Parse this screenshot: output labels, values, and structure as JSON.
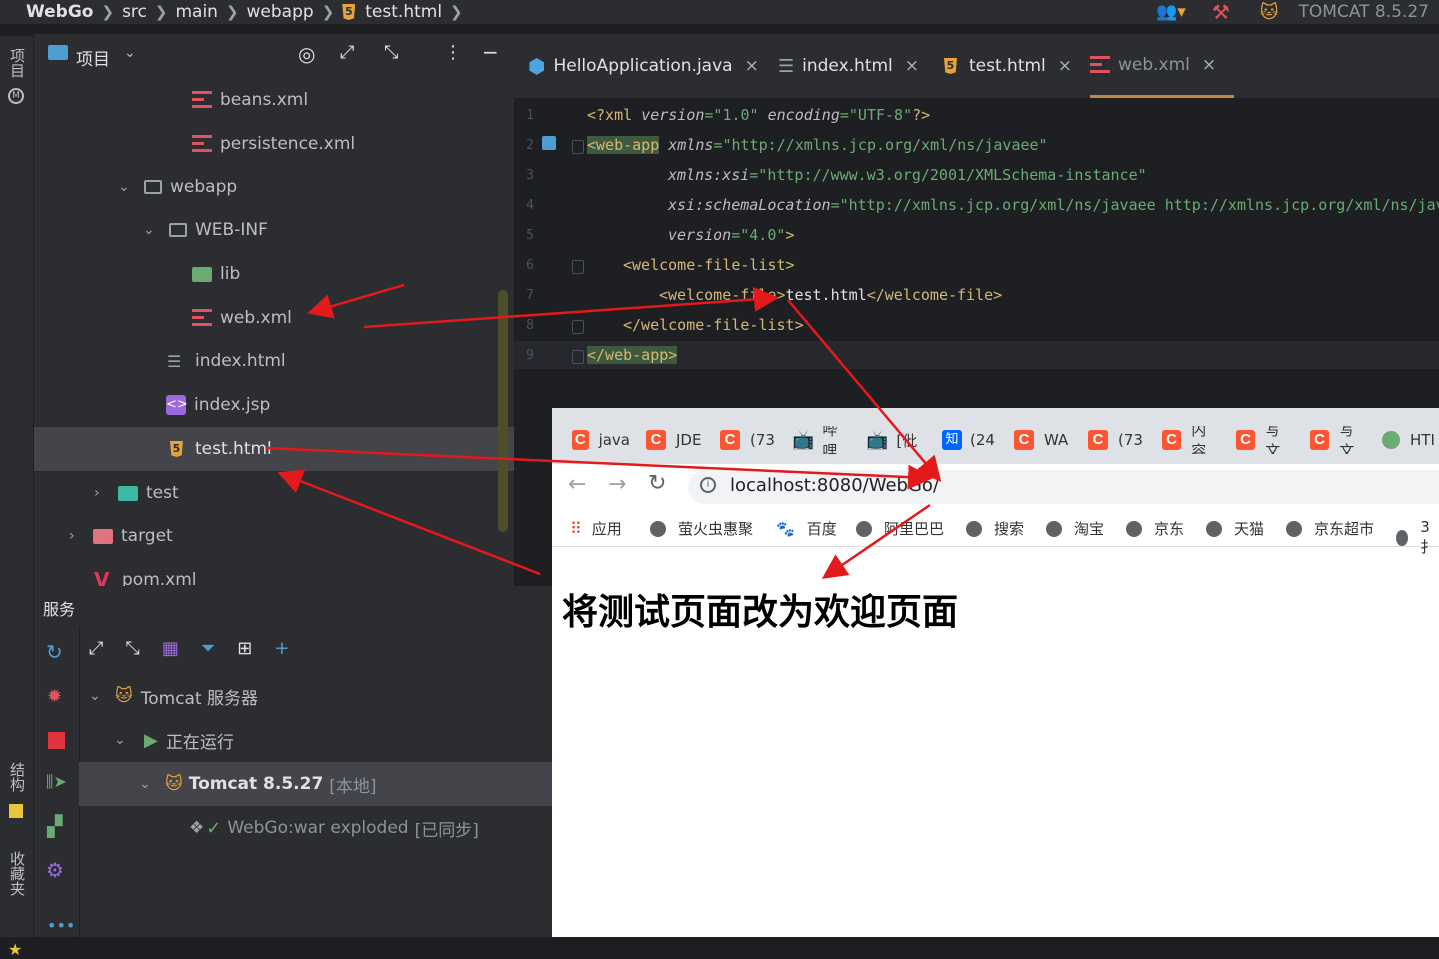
{
  "breadcrumb": {
    "items": [
      "WebGo",
      "src",
      "main",
      "webapp",
      "test.html"
    ]
  },
  "toolbar": {
    "run_config": "TOMCAT 8.5.27"
  },
  "left_strip": {
    "project_label": "项目",
    "structure_label": "结构",
    "favorites_label": "收藏夹"
  },
  "project_panel": {
    "title": "项目",
    "tree": [
      {
        "label": "beans.xml",
        "type": "xml"
      },
      {
        "label": "persistence.xml",
        "type": "xml"
      },
      {
        "label": "webapp",
        "type": "folder",
        "expanded": true
      },
      {
        "label": "WEB-INF",
        "type": "folder",
        "expanded": true
      },
      {
        "label": "lib",
        "type": "lib-folder"
      },
      {
        "label": "web.xml",
        "type": "xml"
      },
      {
        "label": "index.html",
        "type": "html"
      },
      {
        "label": "index.jsp",
        "type": "jsp"
      },
      {
        "label": "test.html",
        "type": "html5",
        "selected": true
      },
      {
        "label": "test",
        "type": "test-folder",
        "expanded": false
      },
      {
        "label": "target",
        "type": "target-folder",
        "expanded": false
      },
      {
        "label": "pom.xml",
        "type": "maven"
      }
    ]
  },
  "editor": {
    "tabs": [
      {
        "label": "HelloApplication.java"
      },
      {
        "label": "index.html"
      },
      {
        "label": "test.html"
      },
      {
        "label": "web.xml",
        "active": true
      }
    ],
    "line_numbers": [
      "1",
      "2",
      "3",
      "4",
      "5",
      "6",
      "7",
      "8",
      "9"
    ],
    "code": {
      "l1_prolog_open": "<?xml ",
      "l1_attr1": "version",
      "l1_val1": "=\"1.0\" ",
      "l1_attr2": "encoding",
      "l1_val2": "=\"UTF-8\"",
      "l1_close": "?>",
      "l2_tag": "<web-app",
      "l2_attr": " xmlns",
      "l2_val": "=\"http://xmlns.jcp.org/xml/ns/javaee\"",
      "l3_attr": "xmlns:xsi",
      "l3_val": "=\"http://www.w3.org/2001/XMLSchema-instance\"",
      "l4_attr": "xsi:schemaLocation",
      "l4_val": "=\"http://xmlns.jcp.org/xml/ns/javaee http://xmlns.jcp.org/xml/ns/jav",
      "l5_attr": "version",
      "l5_val": "=\"4.0\"",
      "l5_close": ">",
      "l6": "<welcome-file-list>",
      "l7_open": "<welcome-file>",
      "l7_text": "test.html",
      "l7_close": "</welcome-file>",
      "l8": "</welcome-file-list>",
      "l9": "</web-app>"
    }
  },
  "services": {
    "title": "服务",
    "tree": [
      {
        "label": "Tomcat 服务器"
      },
      {
        "label": "正在运行"
      },
      {
        "label": "Tomcat 8.5.27",
        "suffix": "[本地]"
      },
      {
        "label": "WebGo:war exploded",
        "suffix": "[已同步]"
      }
    ]
  },
  "browser": {
    "tabs": [
      "java",
      "JDE",
      "(73",
      "哔哩",
      "[仳",
      "(24",
      "WA",
      "(73",
      "内容",
      "写文",
      "写文",
      "HTI"
    ],
    "url": "localhost:8080/WebGo/",
    "bookmarks": [
      "应用",
      "萤火虫惠聚",
      "百度",
      "阿里巴巴",
      "搜索",
      "淘宝",
      "京东",
      "天猫",
      "京东超市",
      "3扌"
    ],
    "heading": "将测试页面改为欢迎页面"
  },
  "colors": {
    "ide_bg": "#1e1f22",
    "panel_bg": "#2b2d30",
    "selection": "#43454a",
    "xml_tag": "#d5b778",
    "xml_value": "#6aab73",
    "annotation_arrow": "#e3191c",
    "csdn_red": "#fc5531"
  }
}
